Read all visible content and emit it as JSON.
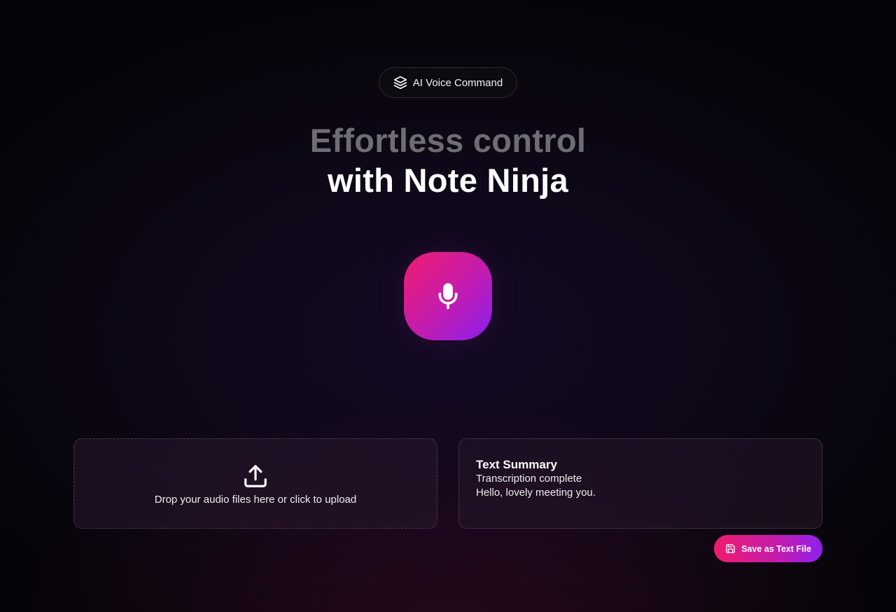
{
  "badge": {
    "icon": "layers-icon",
    "label": "AI Voice Command"
  },
  "hero": {
    "line1": "Effortless control",
    "line2": "with Note Ninja"
  },
  "mic_button": {
    "icon": "microphone-icon"
  },
  "upload": {
    "icon": "upload-icon",
    "label": "Drop your audio files here or click to upload"
  },
  "summary": {
    "title": "Text Summary",
    "status": "Transcription complete",
    "text": "Hello, lovely meeting you."
  },
  "save_button": {
    "icon": "save-icon",
    "label": "Save as Text File"
  },
  "colors": {
    "accent_start": "#f01c6e",
    "accent_end": "#8a1ff0",
    "background": "#0d0716"
  }
}
